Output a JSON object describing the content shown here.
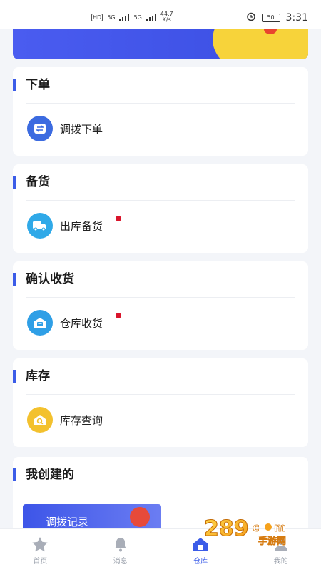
{
  "status_bar": {
    "chip": "HD",
    "net1": "5G",
    "net2": "5G",
    "speed_value": "44.7",
    "speed_unit": "K/s",
    "battery": "50",
    "time": "3:31"
  },
  "sections": [
    {
      "title": "下单",
      "entry": "调拨下单",
      "icon": "swap-icon",
      "badge": false
    },
    {
      "title": "备货",
      "entry": "出库备货",
      "icon": "truck-icon",
      "badge": true
    },
    {
      "title": "确认收货",
      "entry": "仓库收货",
      "icon": "warehouse-icon",
      "badge": true
    },
    {
      "title": "库存",
      "entry": "库存查询",
      "icon": "search-house-icon",
      "badge": false
    },
    {
      "title": "我创建的",
      "entry": "调拨记录",
      "icon": "record-banner",
      "badge": false
    }
  ],
  "tabbar": {
    "items": [
      {
        "label": "首页",
        "icon": "star-icon",
        "active": false
      },
      {
        "label": "消息",
        "icon": "bell-icon",
        "active": false
      },
      {
        "label": "仓库",
        "icon": "home-icon",
        "active": true
      },
      {
        "label": "我的",
        "icon": "person-icon",
        "active": false
      }
    ]
  },
  "watermark": {
    "text": "289 手游网"
  },
  "colors": {
    "accent": "#3b5ce8",
    "badge": "#d9142b",
    "icon_blue": "#3c6be0",
    "icon_cyan": "#2fa9e8",
    "icon_sky": "#2f9fe6",
    "icon_yellow": "#f3c12e",
    "banner_yellow": "#f7d33a"
  }
}
